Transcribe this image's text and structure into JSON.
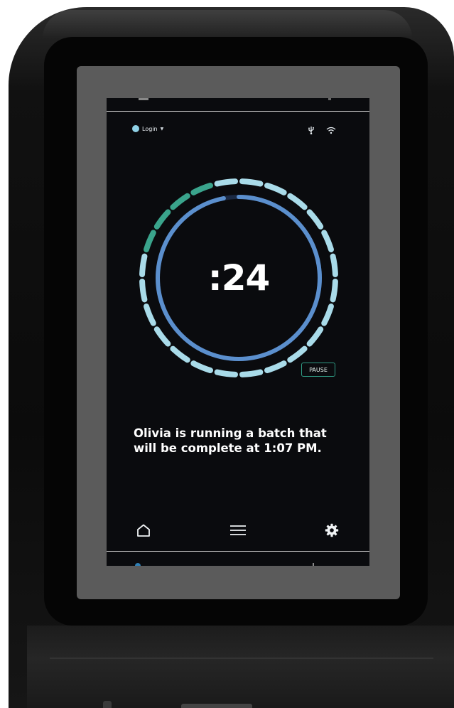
{
  "screen": {
    "login_label": "Login",
    "timer_value": ":24",
    "pause_label": "PAUSE",
    "message_line1": "Olivia is running a batch that",
    "message_line2": "will be complete at 1:07 PM.",
    "progress_fraction": 0.97
  },
  "status_icons": [
    "usb-icon",
    "wifi-icon"
  ],
  "nav": [
    "home-icon",
    "menu-icon",
    "settings-gear-icon"
  ],
  "colors": {
    "screen_bg": "#0a0b0e",
    "ring_blue": "#5b8fcd",
    "ring_track": "#1b2a44",
    "dash_light": "#a9dbe9",
    "dash_teal": "#3aa48c",
    "pause_border": "#2f9a83",
    "login_dot": "#8fd1e6"
  }
}
